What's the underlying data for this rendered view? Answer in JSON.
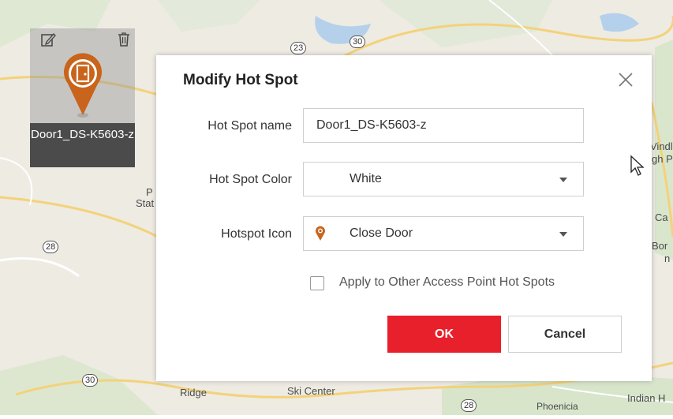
{
  "map": {
    "labels": {
      "p_stat_1": "P",
      "p_stat_2": "Stat",
      "right_top_1": "Vindl",
      "right_top_2": "gh P",
      "right_mid_1": "Ca",
      "right_mid_2": "Bor",
      "right_mid_3": "n",
      "ridge": "Ridge",
      "ski_center": "Ski Center",
      "phoenicia": "Phoenicia",
      "indian": "Indian H"
    },
    "routes": {
      "r23": "23",
      "r30_top": "30",
      "r28_left": "28",
      "r30_bottom": "30",
      "r28_bottom": "28"
    }
  },
  "hotspot": {
    "caption": "Door1_DS-K5603-z",
    "pin_color": "#c8641b"
  },
  "dialog": {
    "title": "Modify Hot Spot",
    "name_label": "Hot Spot name",
    "name_value": "Door1_DS-K5603-z",
    "color_label": "Hot Spot Color",
    "color_value": "White",
    "icon_label": "Hotspot Icon",
    "icon_value": "Close Door",
    "apply_label": "Apply to Other Access Point Hot Spots",
    "apply_checked": false,
    "ok_label": "OK",
    "cancel_label": "Cancel",
    "accent_color": "#e8202b"
  }
}
